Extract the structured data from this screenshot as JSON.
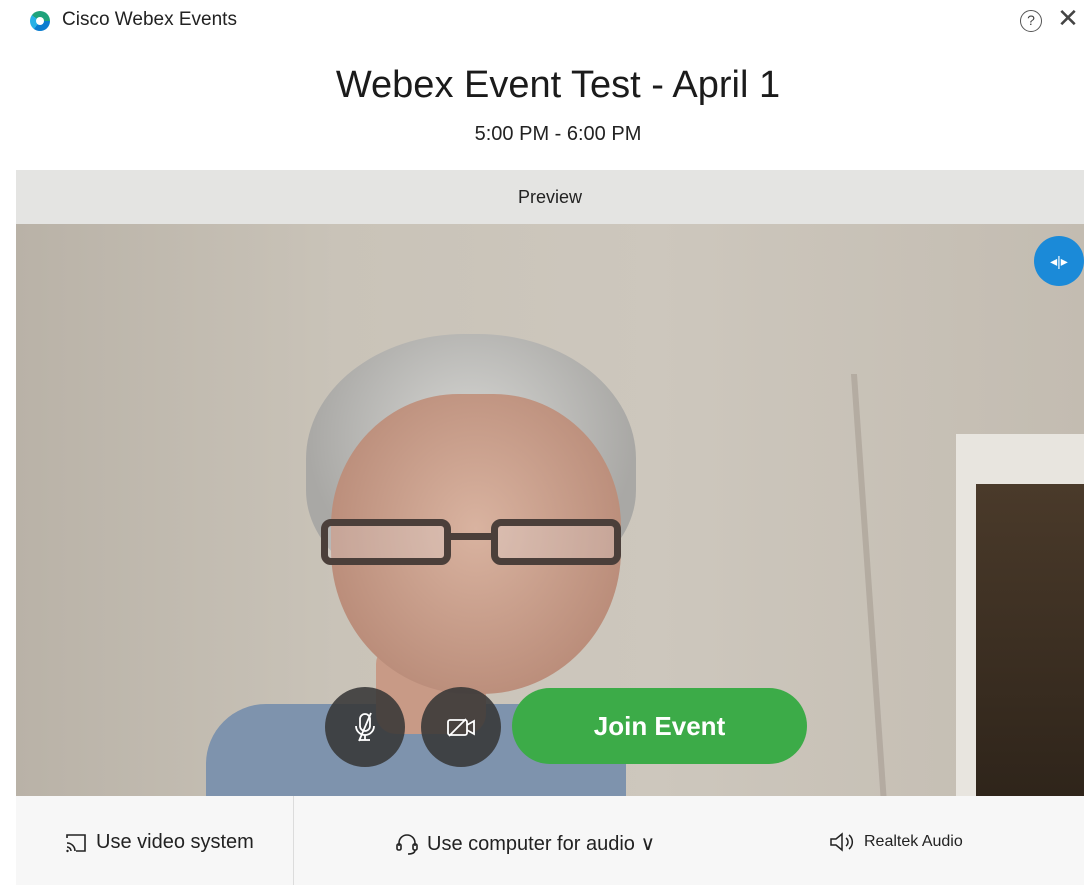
{
  "app": {
    "title": "Cisco Webex Events"
  },
  "window": {
    "help_icon": "help-circle-icon",
    "close_icon": "close-icon",
    "close_glyph": "✕",
    "help_glyph": "?"
  },
  "event": {
    "title": "Webex Event Test - April 1",
    "time": "5:00 PM - 6:00 PM"
  },
  "preview": {
    "label": "Preview",
    "mirror_glyph": "◂|▸"
  },
  "controls": {
    "mute_icon": "microphone-muted-icon",
    "video_icon": "camera-off-icon",
    "join_label": "Join Event",
    "join_color": "#3cab48"
  },
  "footer": {
    "video_system_label": "Use video system",
    "audio_label": "Use computer for audio ∨",
    "speaker_label": "Realtek Audio"
  },
  "colors": {
    "accent_blue": "#1b8ad8",
    "join_green": "#3cab48"
  }
}
